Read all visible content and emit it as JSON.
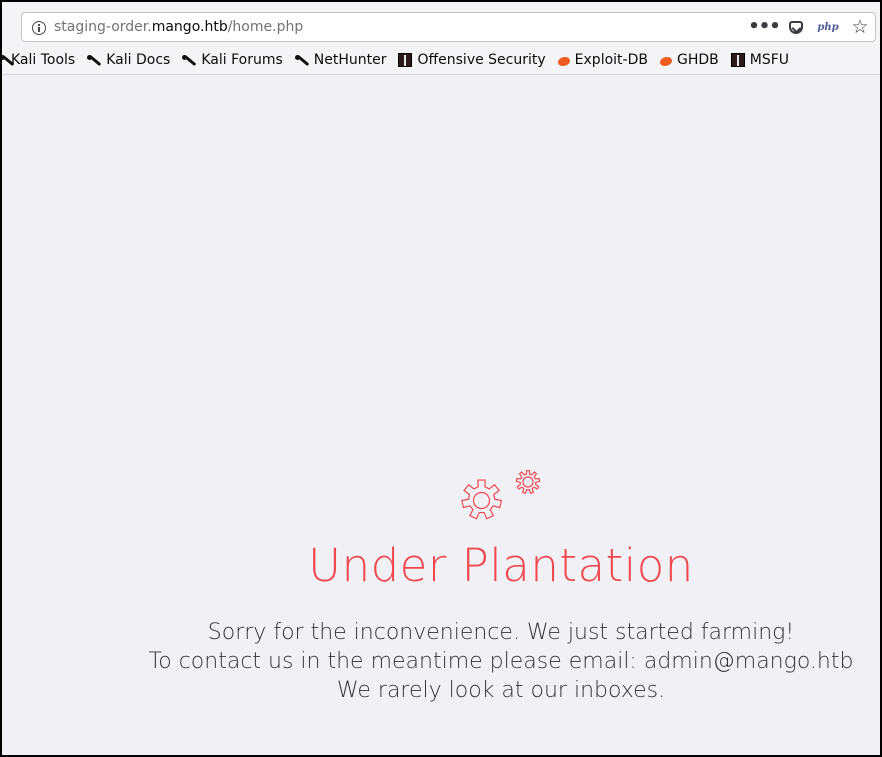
{
  "browser": {
    "url_prefix": "staging-order.",
    "url_host": "mango.htb",
    "url_path": "/home.php",
    "actions": {
      "more": "•••",
      "php_badge": "php",
      "bookmark_star": "☆"
    },
    "bookmarks": [
      {
        "label": "Kali Tools",
        "icon": "kali-dragon-icon"
      },
      {
        "label": "Kali Docs",
        "icon": "kali-dragon-icon"
      },
      {
        "label": "Kali Forums",
        "icon": "kali-dragon-icon"
      },
      {
        "label": "NetHunter",
        "icon": "kali-dragon-icon"
      },
      {
        "label": "Offensive Security",
        "icon": "offsec-icon"
      },
      {
        "label": "Exploit-DB",
        "icon": "exploitdb-icon"
      },
      {
        "label": "GHDB",
        "icon": "exploitdb-icon"
      },
      {
        "label": "MSFU",
        "icon": "offsec-icon"
      }
    ]
  },
  "page": {
    "title": "Under Plantation",
    "line1": "Sorry for the inconvenience. We just started farming!",
    "line2": "To contact us in the meantime please email: admin@mango.htb",
    "line3": "We rarely look at our inboxes."
  },
  "colors": {
    "accent": "#f0474e",
    "background": "#f1f0f5",
    "text": "#333338"
  }
}
